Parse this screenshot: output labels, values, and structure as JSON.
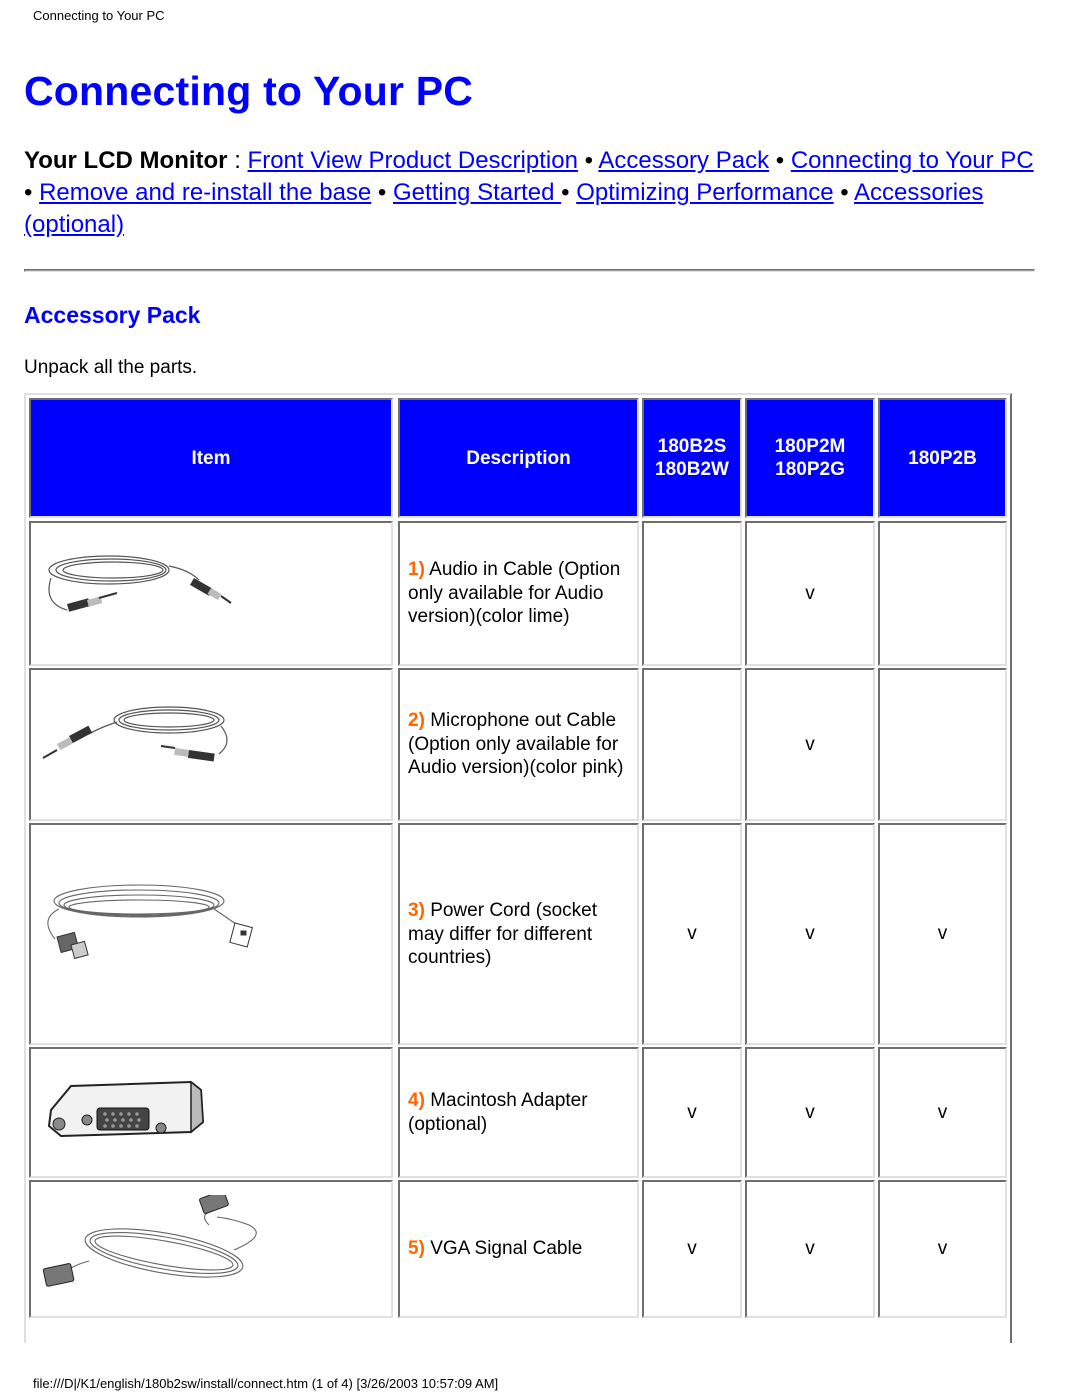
{
  "running_head": "Connecting to Your PC",
  "title": "Connecting to Your PC",
  "nav": {
    "lead": "Your LCD Monitor",
    "lead_sep": " : ",
    "links": [
      "Front View Product Description",
      "Accessory Pack",
      "Connecting to Your PC",
      "Remove and re-install the base",
      "Getting Started ",
      "Optimizing Performance",
      "Accessories (optional)"
    ],
    "bullet": " • "
  },
  "section_title": "Accessory Pack",
  "intro": "Unpack all the parts.",
  "table": {
    "headers": {
      "item": "Item",
      "description": "Description",
      "model_a": [
        "180B2S",
        "180B2W"
      ],
      "model_b": [
        "180P2M",
        "180P2G"
      ],
      "model_c": "180P2B"
    },
    "rows": [
      {
        "num": "1)",
        "text": "Audio in Cable (Option only available for Audio version)(color lime)",
        "image": "audio-cable-illustration",
        "model_a": "",
        "model_b": "v",
        "model_c": ""
      },
      {
        "num": "2)",
        "text": "Microphone out Cable (Option only available for Audio version)(color pink)",
        "image": "microphone-cable-illustration",
        "model_a": "",
        "model_b": "v",
        "model_c": ""
      },
      {
        "num": "3)",
        "text": "Power Cord (socket may differ for different countries)",
        "image": "power-cord-illustration",
        "model_a": "v",
        "model_b": "v",
        "model_c": "v"
      },
      {
        "num": "4)",
        "text": "Macintosh Adapter (optional)",
        "image": "mac-adapter-illustration",
        "model_a": "v",
        "model_b": "v",
        "model_c": "v"
      },
      {
        "num": "5)",
        "text": "VGA Signal Cable",
        "image": "vga-cable-illustration",
        "model_a": "v",
        "model_b": "v",
        "model_c": "v"
      }
    ]
  },
  "colors": {
    "heading_blue": "#0000ff",
    "link_blue": "#0000ff",
    "header_cell_bg": "#0000ff",
    "number_orange": "#ff6600"
  },
  "footer": "file:///D|/K1/english/180b2sw/install/connect.htm (1 of 4) [3/26/2003 10:57:09 AM]"
}
